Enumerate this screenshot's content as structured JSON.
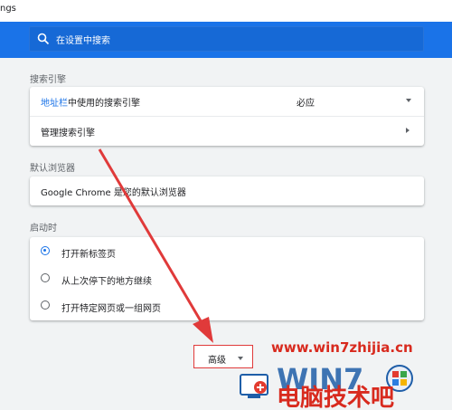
{
  "address_bar": {
    "text": "ngs"
  },
  "search": {
    "placeholder": "在设置中搜索"
  },
  "search_engine": {
    "section_title": "搜索引擎",
    "row1_link": "地址栏",
    "row1_rest": "中使用的搜索引擎",
    "row1_value": "必应",
    "row2_label": "管理搜索引擎"
  },
  "default_browser": {
    "section_title": "默认浏览器",
    "text": "Google Chrome 是您的默认浏览器"
  },
  "startup": {
    "section_title": "启动时",
    "options": [
      {
        "label": "打开新标签页",
        "selected": true
      },
      {
        "label": "从上次停下的地方继续",
        "selected": false
      },
      {
        "label": "打开特定网页或一组网页",
        "selected": false
      }
    ]
  },
  "advanced": {
    "label": "高级"
  },
  "watermark": {
    "url": "www.win7zhijia.cn",
    "logo_text": "电脑技术吧"
  },
  "colors": {
    "accent": "#1a73e8",
    "annotation_red": "#e03a3a",
    "watermark_red": "#d82a1e"
  }
}
